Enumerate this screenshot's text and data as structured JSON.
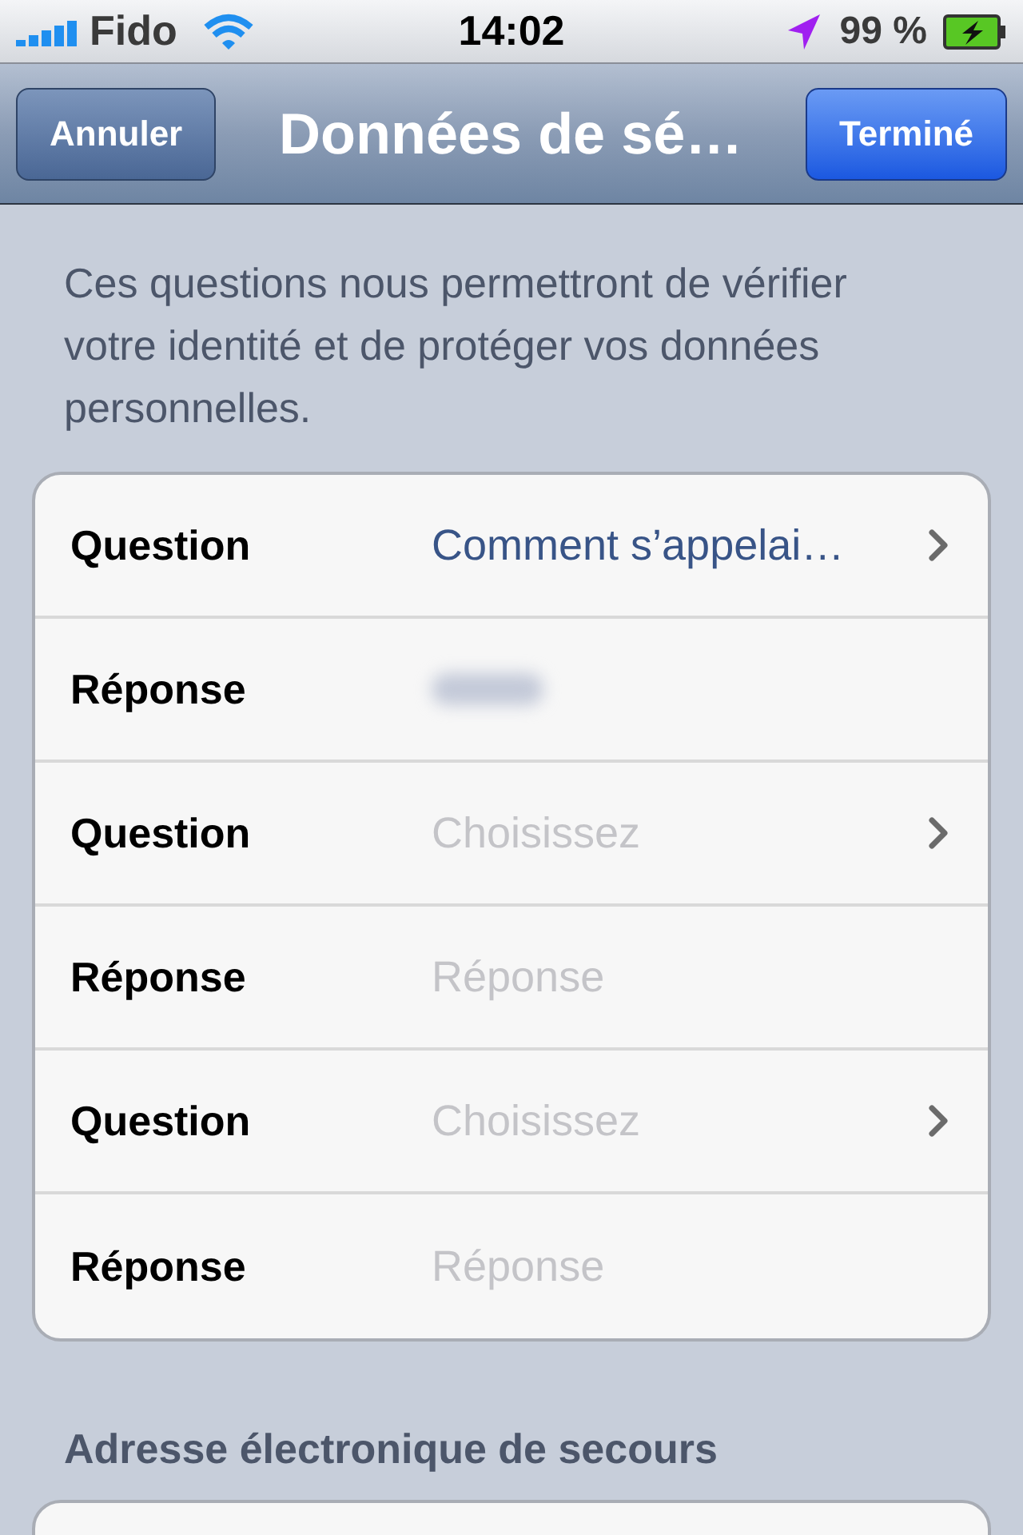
{
  "status_bar": {
    "carrier": "Fido",
    "time": "14:02",
    "battery": "99 %"
  },
  "nav_bar": {
    "left_button": "Annuler",
    "title": "Données de sé…",
    "right_button": "Terminé"
  },
  "intro": "Ces questions nous permettront de vérifier votre identité et de protéger vos données personnelles.",
  "rows": [
    {
      "kind": "picker",
      "label": "Question",
      "value": "Comment s’appelai…"
    },
    {
      "kind": "text",
      "label": "Réponse",
      "blurred": true
    },
    {
      "kind": "picker",
      "label": "Question",
      "placeholder": "Choisissez"
    },
    {
      "kind": "text",
      "label": "Réponse",
      "placeholder": "Réponse"
    },
    {
      "kind": "picker",
      "label": "Question",
      "placeholder": "Choisissez"
    },
    {
      "kind": "text",
      "label": "Réponse",
      "placeholder": "Réponse"
    }
  ],
  "section_header": "Adresse électronique de secours"
}
